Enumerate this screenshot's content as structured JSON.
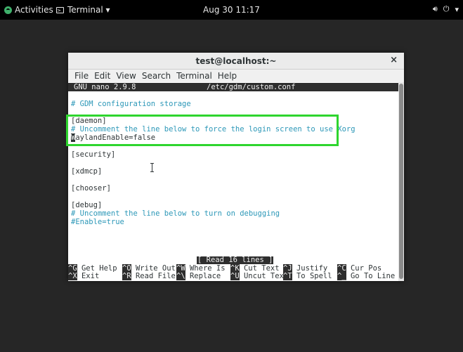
{
  "topbar": {
    "activities": "Activities",
    "app_label": "Terminal ▾",
    "clock": "Aug 30 11:17",
    "volume_icon": "volume-icon",
    "power_icon": "power-icon",
    "dropdown": "▾"
  },
  "window": {
    "title": "test@localhost:~",
    "close": "×",
    "menu": [
      "File",
      "Edit",
      "View",
      "Search",
      "Terminal",
      "Help"
    ]
  },
  "nano": {
    "version": "GNU nano 2.9.8",
    "filename": "/etc/gdm/custom.conf",
    "lines": [
      {
        "text": "# GDM configuration storage",
        "comment": true
      },
      {
        "text": "",
        "comment": false
      },
      {
        "text": "[daemon]",
        "comment": false
      },
      {
        "text": "# Uncomment the line below to force the login screen to use Xorg",
        "comment": true
      },
      {
        "text": "WaylandEnable=false",
        "comment": false
      },
      {
        "text": "",
        "comment": false
      },
      {
        "text": "[security]",
        "comment": false
      },
      {
        "text": "",
        "comment": false
      },
      {
        "text": "[xdmcp]",
        "comment": false
      },
      {
        "text": "",
        "comment": false
      },
      {
        "text": "[chooser]",
        "comment": false
      },
      {
        "text": "",
        "comment": false
      },
      {
        "text": "[debug]",
        "comment": false
      },
      {
        "text": "# Uncomment the line below to turn on debugging",
        "comment": true
      },
      {
        "text": "#Enable=true",
        "comment": true
      }
    ],
    "status": "[ Read 16 lines ]",
    "shortcuts_row1": [
      {
        "key": "^G",
        "label": "Get Help"
      },
      {
        "key": "^O",
        "label": "Write Out"
      },
      {
        "key": "^W",
        "label": "Where Is"
      },
      {
        "key": "^K",
        "label": "Cut Text"
      },
      {
        "key": "^J",
        "label": "Justify"
      },
      {
        "key": "^C",
        "label": "Cur Pos"
      }
    ],
    "shortcuts_row2": [
      {
        "key": "^X",
        "label": "Exit"
      },
      {
        "key": "^R",
        "label": "Read File"
      },
      {
        "key": "^\\",
        "label": "Replace"
      },
      {
        "key": "^U",
        "label": "Uncut Text"
      },
      {
        "key": "^T",
        "label": "To Spell"
      },
      {
        "key": "^_",
        "label": "Go To Line"
      }
    ]
  },
  "colors": {
    "highlight": "#2ed52e",
    "comment": "#2d98b8"
  }
}
